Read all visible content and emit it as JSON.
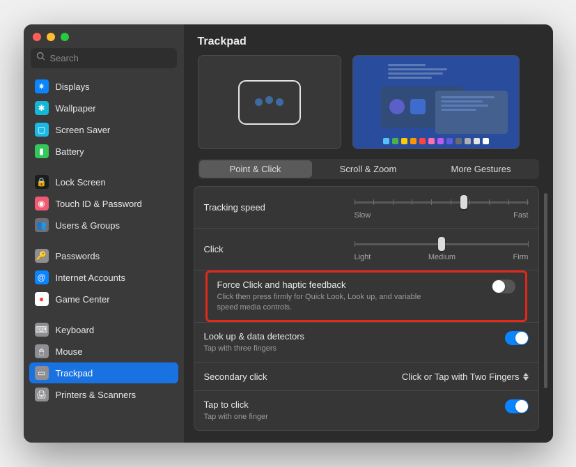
{
  "search": {
    "placeholder": "Search"
  },
  "page": {
    "title": "Trackpad"
  },
  "sidebar": {
    "items": [
      {
        "label": "Displays",
        "icon_bg": "#0a84ff",
        "glyph": "✷"
      },
      {
        "label": "Wallpaper",
        "icon_bg": "#15b7d8",
        "glyph": "✱"
      },
      {
        "label": "Screen Saver",
        "icon_bg": "#1cb8e8",
        "glyph": "▢"
      },
      {
        "label": "Battery",
        "icon_bg": "#34c759",
        "glyph": "▮"
      },
      {
        "label": "Lock Screen",
        "icon_bg": "#1c1c1c",
        "glyph": "🔒"
      },
      {
        "label": "Touch ID & Password",
        "icon_bg": "#ef5b72",
        "glyph": "◉"
      },
      {
        "label": "Users & Groups",
        "icon_bg": "#6f6f73",
        "glyph": "👥"
      },
      {
        "label": "Passwords",
        "icon_bg": "#8e8e93",
        "glyph": "🔑"
      },
      {
        "label": "Internet Accounts",
        "icon_bg": "#0a84ff",
        "glyph": "@"
      },
      {
        "label": "Game Center",
        "icon_bg": "#ffffff",
        "glyph": "●"
      },
      {
        "label": "Keyboard",
        "icon_bg": "#8e8e93",
        "glyph": "⌨"
      },
      {
        "label": "Mouse",
        "icon_bg": "#8e8e93",
        "glyph": "🖱"
      },
      {
        "label": "Trackpad",
        "icon_bg": "#8e8e93",
        "glyph": "▭"
      },
      {
        "label": "Printers & Scanners",
        "icon_bg": "#8e8e93",
        "glyph": "🖨"
      }
    ]
  },
  "tabs": {
    "point_click": "Point & Click",
    "scroll_zoom": "Scroll & Zoom",
    "more_gestures": "More Gestures"
  },
  "settings": {
    "tracking": {
      "title": "Tracking speed",
      "min": "Slow",
      "max": "Fast",
      "ticks": 10,
      "value_pct": 63
    },
    "click": {
      "title": "Click",
      "labels": [
        "Light",
        "Medium",
        "Firm"
      ],
      "ticks": 3,
      "value_pct": 50
    },
    "force_click": {
      "title": "Force Click and haptic feedback",
      "description": "Click then press firmly for Quick Look, Look up, and variable speed media controls.",
      "value": false
    },
    "lookup": {
      "title": "Look up & data detectors",
      "description": "Tap with three fingers",
      "value": true
    },
    "secondary": {
      "title": "Secondary click",
      "selected": "Click or Tap with Two Fingers"
    },
    "tap_to_click": {
      "title": "Tap to click",
      "description": "Tap with one finger",
      "value": true
    }
  },
  "dock_colors": [
    "#55c1ff",
    "#4caf50",
    "#ffcc00",
    "#ff9500",
    "#ff453a",
    "#ff6fb4",
    "#bf5af2",
    "#5e5ce6",
    "#6b6b6b",
    "#b0b0b0",
    "#e4e4e4",
    "#ffffff"
  ]
}
